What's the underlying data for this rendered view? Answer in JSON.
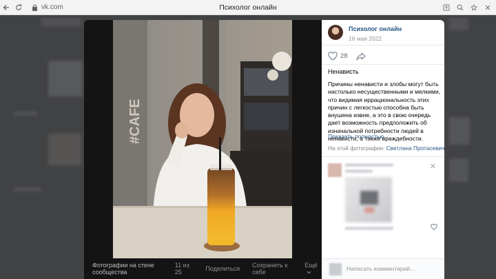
{
  "browser": {
    "back_icon": "arrow-left-icon",
    "reload_icon": "reload-icon",
    "url": "vk.com",
    "title": "Психолог онлайн"
  },
  "photo_bar": {
    "album": "Фотографии на стене сообщества",
    "counter": "11 из 25",
    "share": "Поделиться",
    "save": "Сохранить к себе",
    "more": "Ещё"
  },
  "post": {
    "author": "Психолог онлайн",
    "date": "16 мая 2022",
    "likes": "28",
    "title": "Ненависть",
    "body": "Причины ненависти и злобы могут быть настолько несущественными и мелкими, что видимая иррациональность этих причин с легкостью способна быть внушена извне, а это в свою очередь дает возможность предположить об изначальной потребности людей в ненависти, а также враждебности.",
    "show_more": "Показать полностью…",
    "tagged_label": "На этой фотографии:",
    "tagged_name": "Светлана Протасевич"
  },
  "comment_input": {
    "placeholder": "Написать комментарий..."
  },
  "colors": {
    "link": "#2a5885",
    "muted": "#939393"
  }
}
